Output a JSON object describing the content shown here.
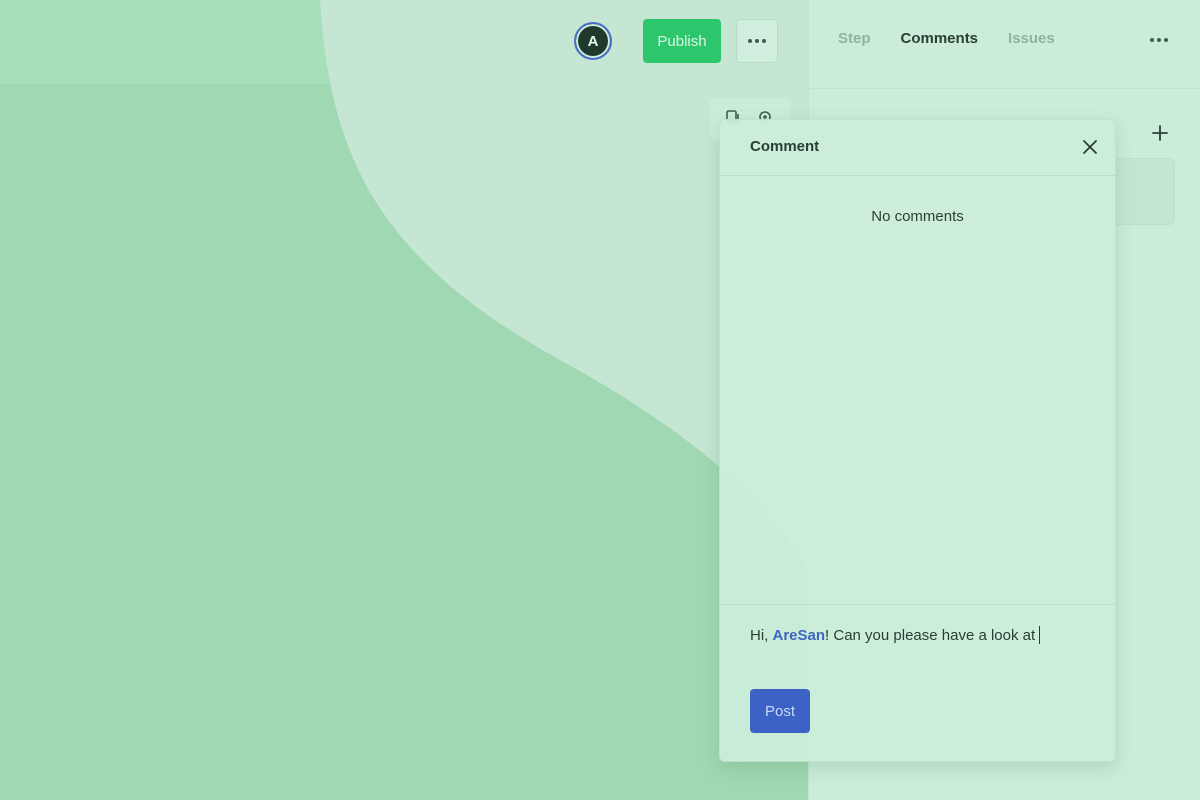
{
  "toolbar": {
    "avatar_initial": "A",
    "publish_label": "Publish",
    "more_icon": "more-horizontal-icon"
  },
  "mini_toolbar": {
    "icons": [
      "copy-icon",
      "gear-icon"
    ]
  },
  "right_panel": {
    "tabs": [
      {
        "label": "Step",
        "active": false
      },
      {
        "label": "Comments",
        "active": true
      },
      {
        "label": "Issues",
        "active": false
      }
    ],
    "more_icon": "more-horizontal-icon",
    "add_icon": "plus-icon"
  },
  "comment_dialog": {
    "title": "Comment",
    "close_icon": "close-icon",
    "empty_text": "No comments",
    "input": {
      "prefix": "Hi, ",
      "mention": "AreSan",
      "suffix": "! Can you please have a look at"
    },
    "post_label": "Post"
  },
  "colors": {
    "accent_green": "#2ec66d",
    "accent_blue": "#3b62c4",
    "background": "#a3dcb6",
    "panel": "#cbecd9"
  }
}
